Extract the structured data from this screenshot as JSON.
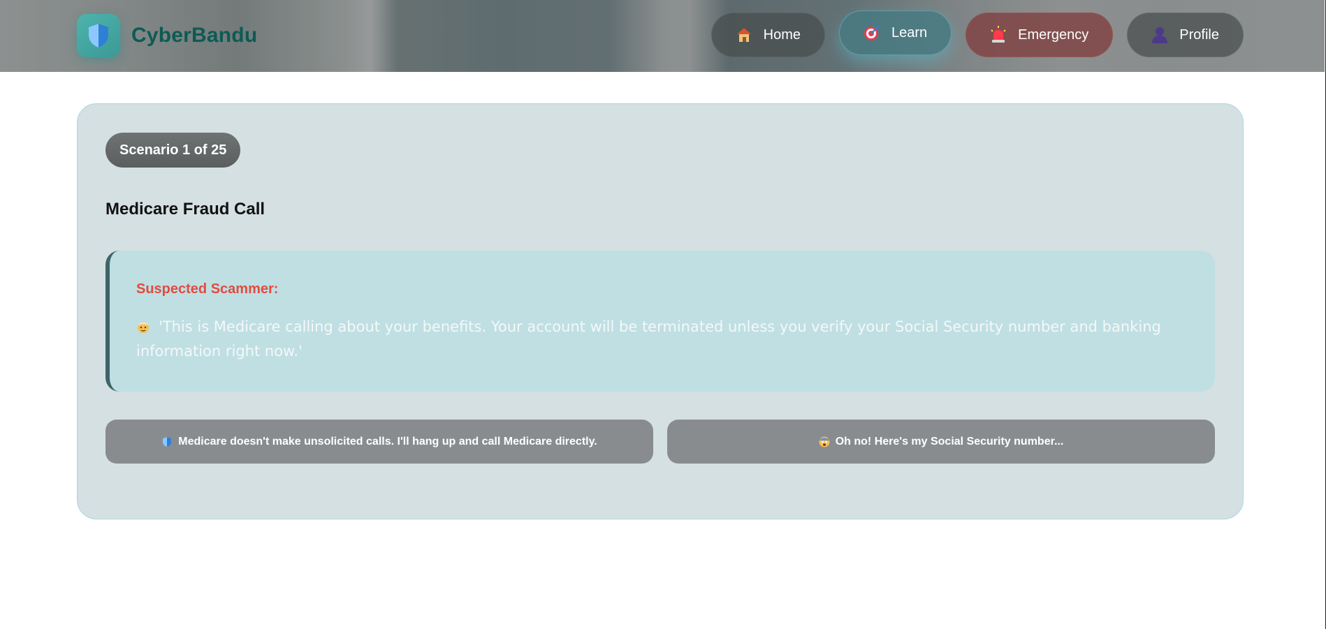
{
  "brand": {
    "name": "CyberBandu",
    "logo_icon": "shield-icon"
  },
  "nav": {
    "items": [
      {
        "label": "Home",
        "icon": "house-icon"
      },
      {
        "label": "Learn",
        "icon": "target-icon"
      },
      {
        "label": "Emergency",
        "icon": "siren-icon"
      },
      {
        "label": "Profile",
        "icon": "person-icon"
      }
    ],
    "active": "Learn"
  },
  "scenario": {
    "badge": "Scenario 1 of 25",
    "title": "Medicare Fraud Call",
    "speaker": "Suspected Scammer:",
    "speaker_icon": "older-person-icon",
    "quote": "'This is Medicare calling about your benefits. Your account will be terminated unless you verify your Social Security number and banking information right now.'",
    "choices": [
      {
        "label": "Medicare doesn't make unsolicited calls. I'll hang up and call Medicare directly.",
        "icon": "shield-icon"
      },
      {
        "label": "Oh no! Here's my Social Security number...",
        "icon": "scared-face-icon"
      }
    ]
  },
  "colors": {
    "brand_text": "#0e5a55",
    "card_bg": "#d5e0e2",
    "dialogue_bg": "#bfdfe3",
    "speaker_red": "#e24b3f",
    "choice_bg": "#888c8f"
  }
}
